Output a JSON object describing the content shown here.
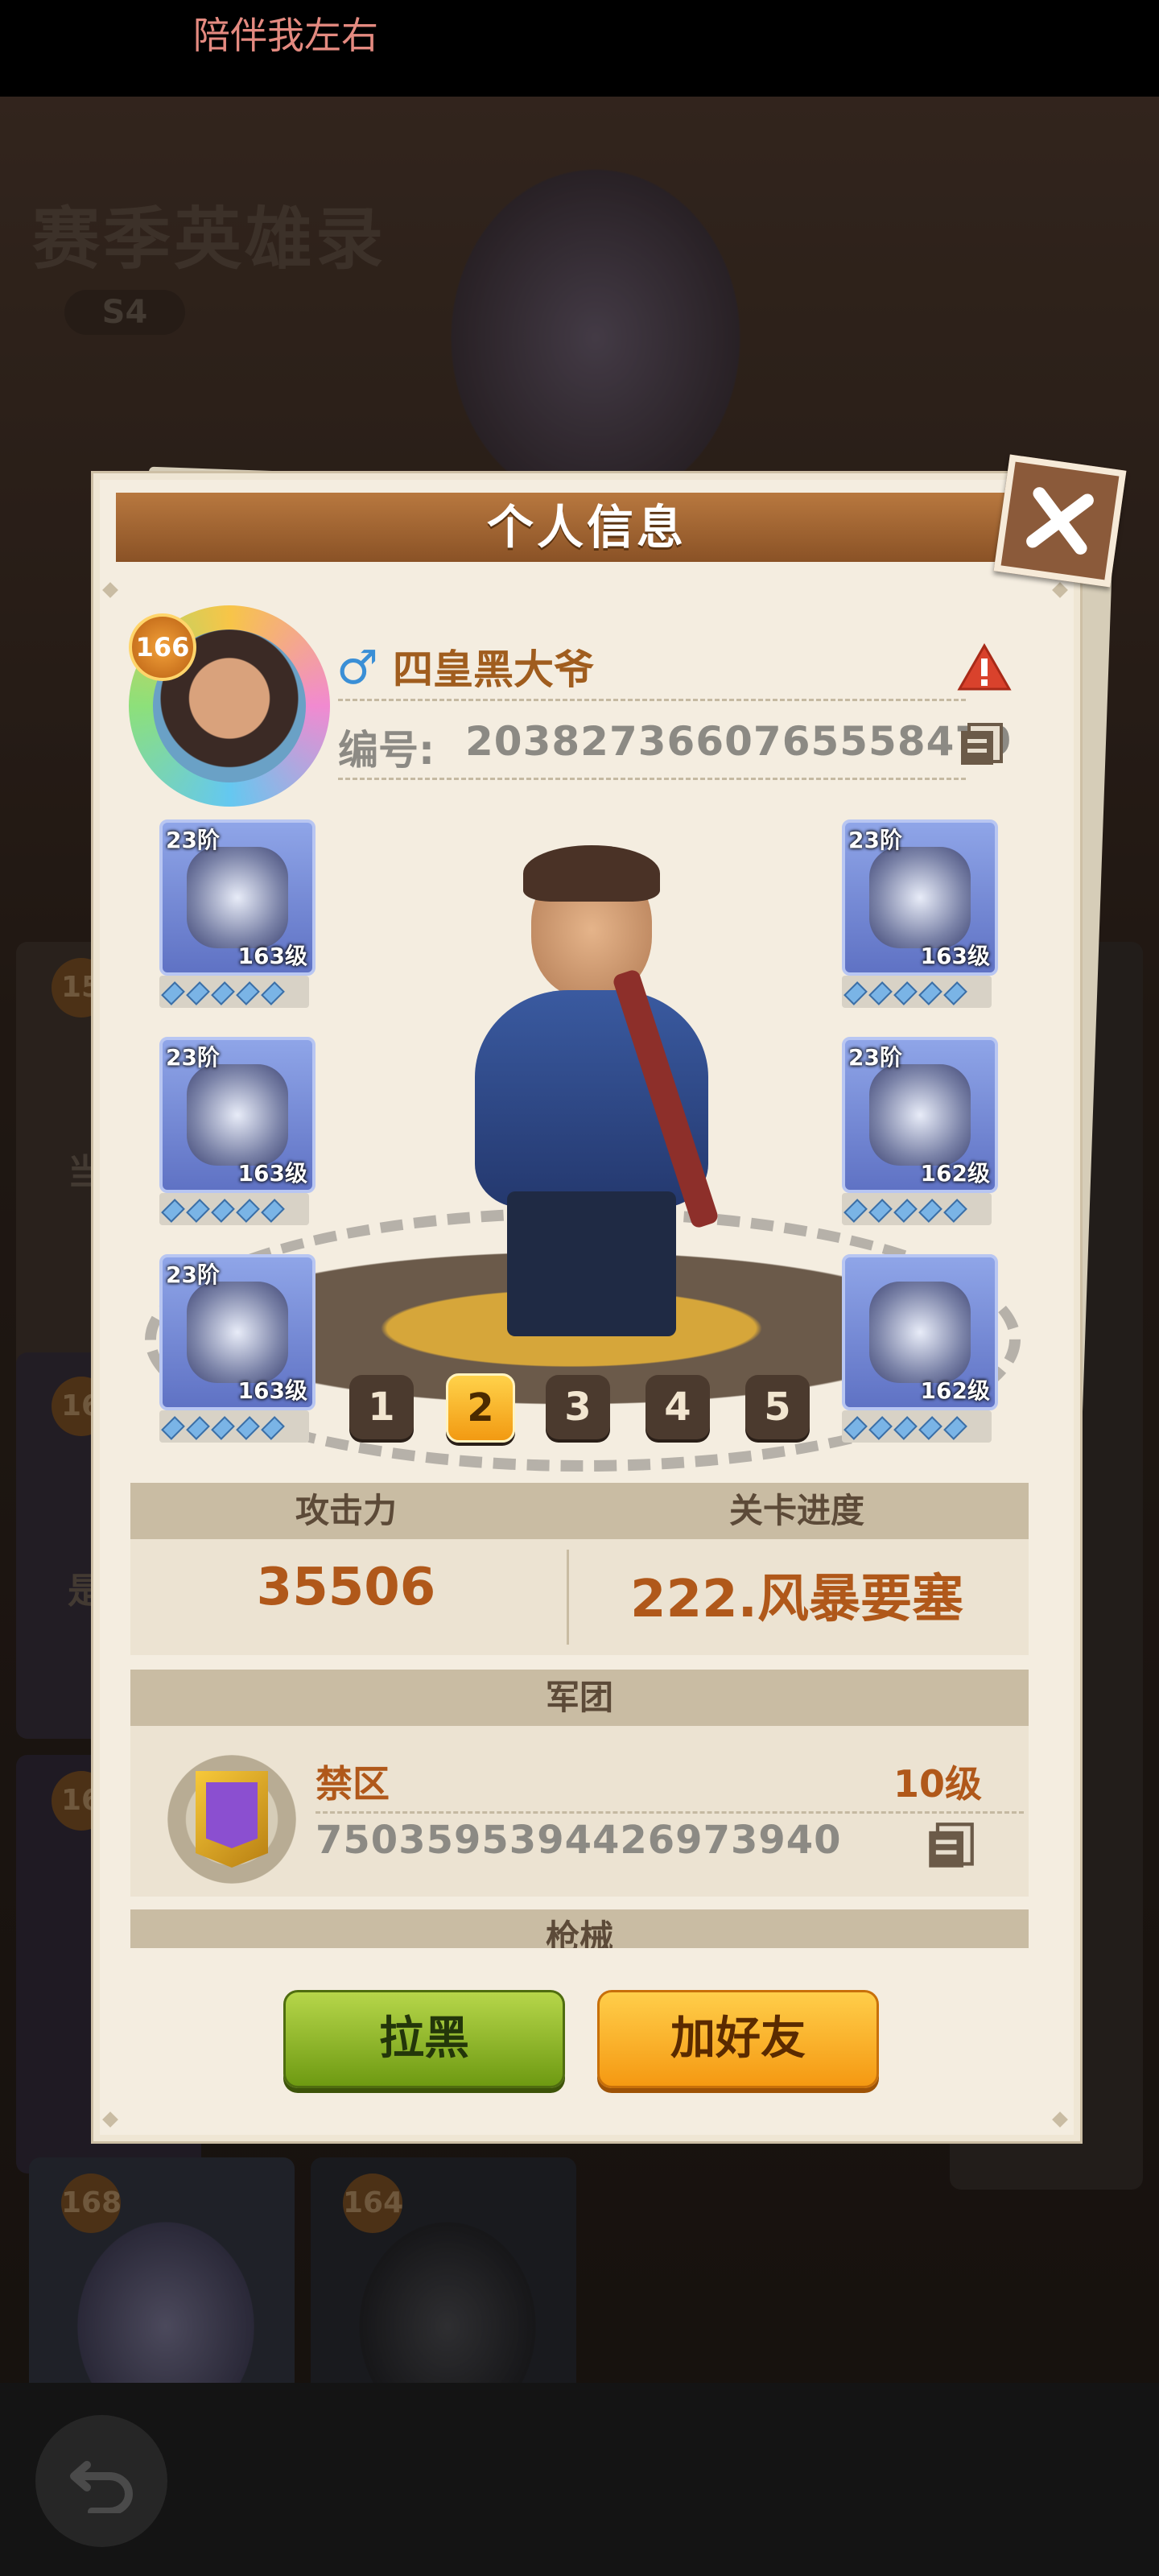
{
  "status_bar": {
    "notification_text": "陪伴我左右"
  },
  "background": {
    "title": "赛季英雄录",
    "season": "S4",
    "bottom_cards": [
      {
        "level": "168"
      },
      {
        "level": "164"
      }
    ],
    "side_badges": [
      {
        "level": "15"
      },
      {
        "level": "16"
      },
      {
        "level": "16"
      }
    ],
    "side_texts": [
      "当",
      "是"
    ]
  },
  "modal": {
    "title": "个人信息",
    "player": {
      "level": "166",
      "gender_symbol": "♂",
      "name": "四皇黑大爷",
      "id_label": "编号:",
      "id_value": "2038273660765558479"
    },
    "equipment_left": [
      {
        "tier": "23阶",
        "level": "163级",
        "gems": 5
      },
      {
        "tier": "23阶",
        "level": "163级",
        "gems": 5
      },
      {
        "tier": "23阶",
        "level": "163级",
        "gems": 5
      }
    ],
    "equipment_right": [
      {
        "tier": "23阶",
        "level": "163级",
        "gems": 5
      },
      {
        "tier": "23阶",
        "level": "162级",
        "gems": 5
      },
      {
        "tier": "",
        "level": "162级",
        "gems": 5
      }
    ],
    "pages": [
      "1",
      "2",
      "3",
      "4",
      "5"
    ],
    "active_page": "2",
    "stats": {
      "attack_label": "攻击力",
      "attack_value": "35506",
      "progress_label": "关卡进度",
      "progress_value": "222.风暴要塞"
    },
    "legion": {
      "section_label": "军团",
      "name": "禁区",
      "level": "10级",
      "id": "7503595394426973940"
    },
    "weapons": {
      "section_label": "枪械"
    },
    "buttons": {
      "block": "拉黑",
      "add_friend": "加好友"
    }
  },
  "colors": {
    "accent_orange": "#b0581a",
    "header_brown": "#8a5226",
    "block_green": "#6e9a12",
    "friend_orange": "#f59912"
  }
}
